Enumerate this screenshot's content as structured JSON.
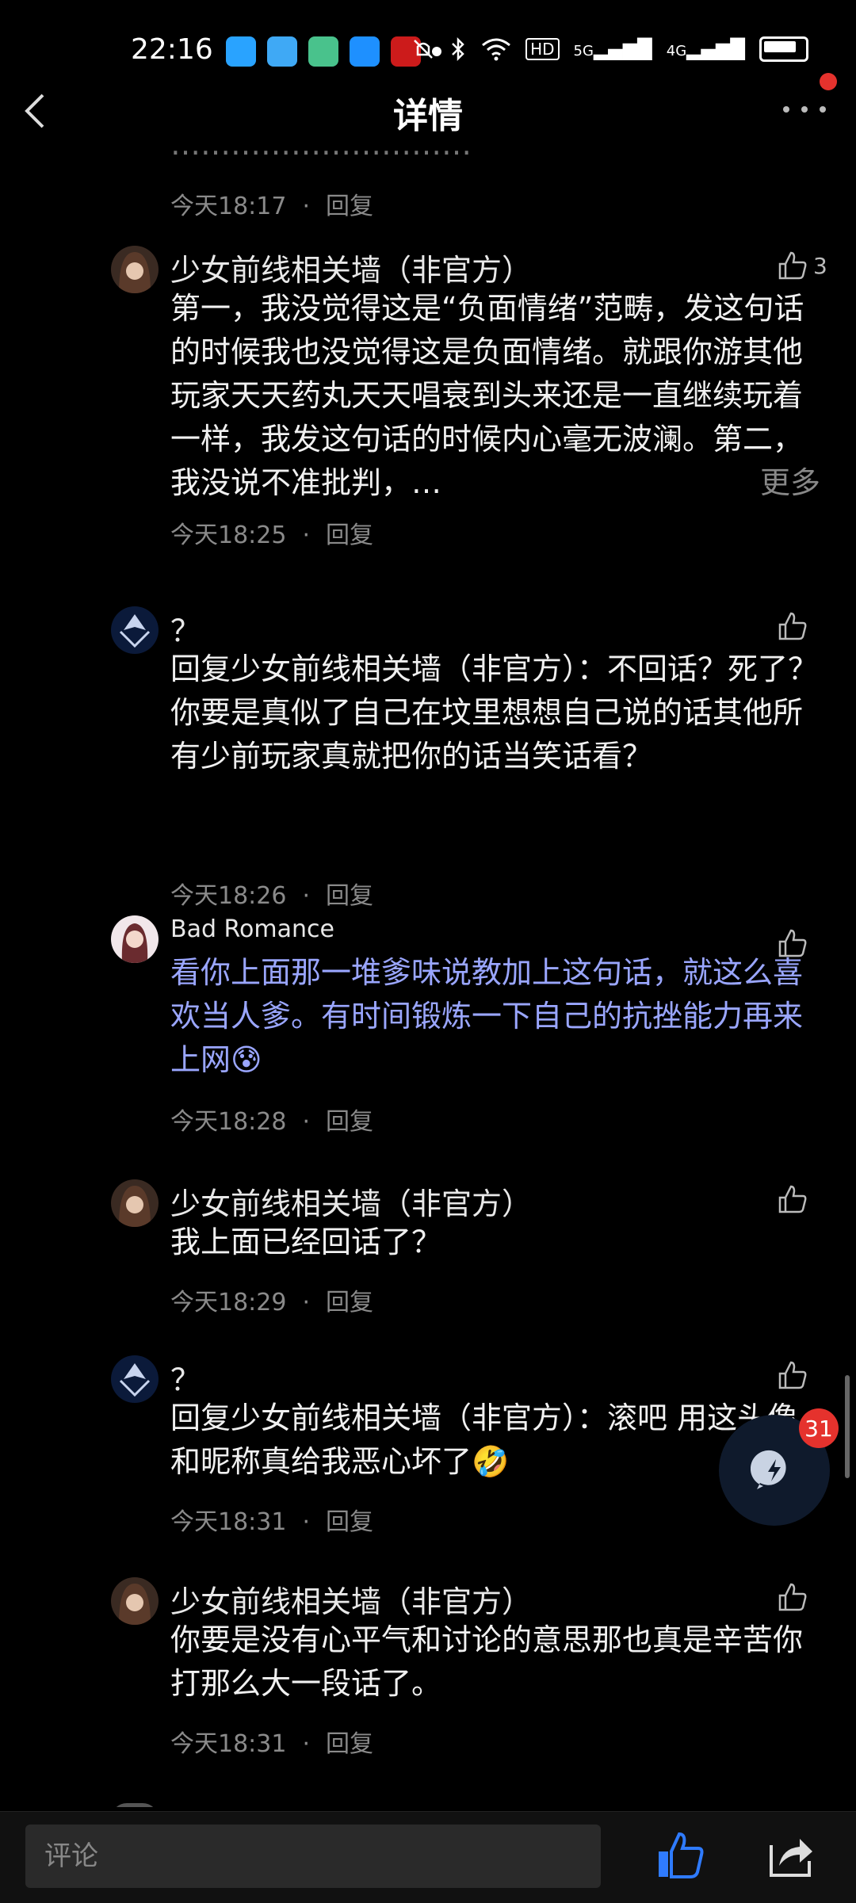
{
  "status": {
    "time": "22:16",
    "hd": "HD",
    "net1": "5G",
    "net2": "4G"
  },
  "header": {
    "title": "详情"
  },
  "faded_text": "…………………………",
  "comments": [
    {
      "time": "今天18:17",
      "reply": "回复"
    },
    {
      "name": "少女前线相关墙（非官方）",
      "likes": "3",
      "text": "第一，我没觉得这是“负面情绪”范畴，发这句话的时候我也没觉得这是负面情绪。就跟你游其他玩家天天药丸天天唱衰到头来还是一直继续玩着一样，我发这句话的时候内心毫无波澜。第二，我没说不准批判，…",
      "more": "更多",
      "time": "今天18:25",
      "reply": "回复"
    },
    {
      "name": "？",
      "text": "回复少女前线相关墙（非官方）：不回话？死了？你要是真似了自己在坟里想想自己说的话其他所有少前玩家真就把你的话当笑话看？",
      "time": "今天18:26",
      "reply": "回复"
    },
    {
      "name": "Bad Romance",
      "text": "看你上面那一堆爹味说教加上这句话，就这么喜欢当人爹。有时间锻炼一下自己的抗挫能力再来上网😰",
      "time": "今天18:28",
      "reply": "回复"
    },
    {
      "name": "少女前线相关墙（非官方）",
      "text": "我上面已经回话了？",
      "time": "今天18:29",
      "reply": "回复"
    },
    {
      "name": "？",
      "text": "回复少女前线相关墙（非官方）：滚吧 用这头像和昵称真给我恶心坏了🤣",
      "time": "今天18:31",
      "reply": "回复"
    },
    {
      "name": "少女前线相关墙（非官方）",
      "text": "你要是没有心平气和讨论的意思那也真是辛苦你打那么大一段话了。",
      "time": "今天18:31",
      "reply": "回复"
    }
  ],
  "fab": {
    "badge": "31"
  },
  "bottom": {
    "placeholder": "评论"
  },
  "colors": {
    "accent": "#2f7bff",
    "badge": "#e5322d",
    "highlight_text": "#9aa6ff"
  }
}
